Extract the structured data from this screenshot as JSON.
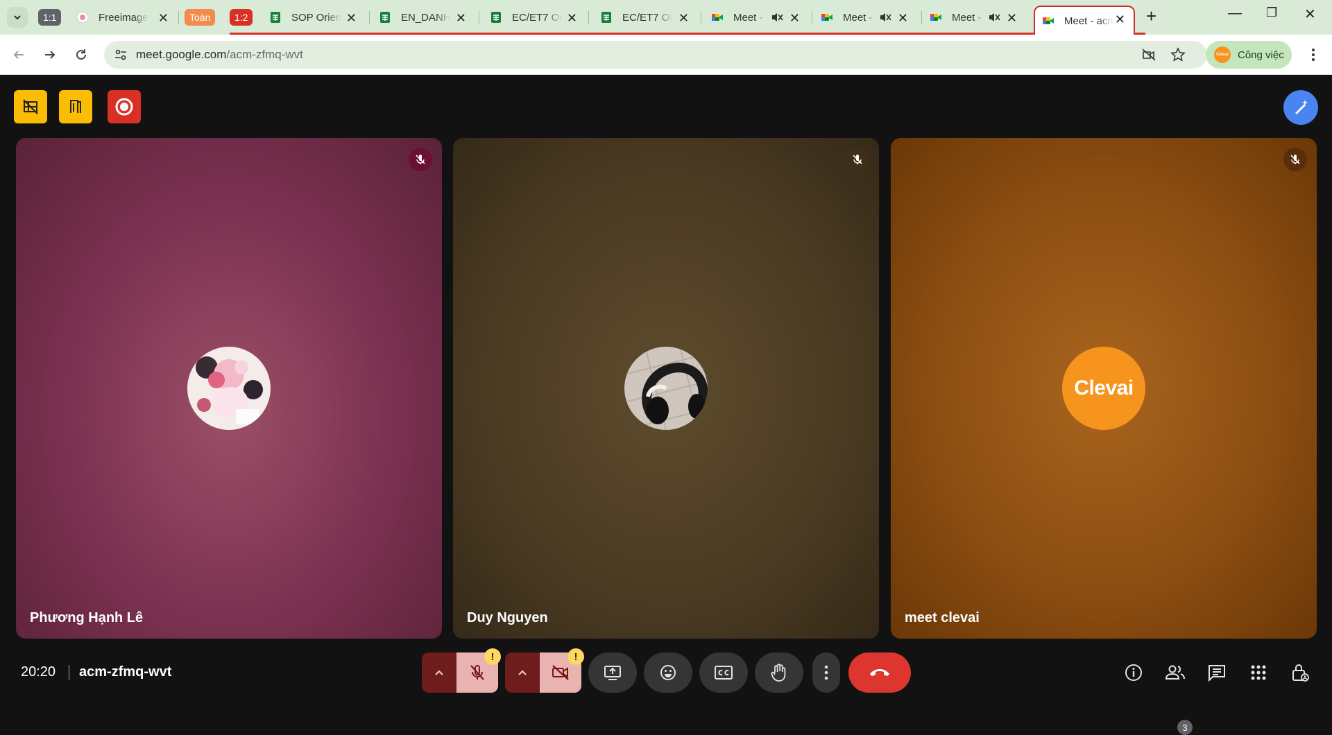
{
  "browser": {
    "tab_groups": [
      {
        "label": "1:1",
        "color": "#5f6368"
      },
      {
        "label": "Toán",
        "color": "#f28b4c"
      },
      {
        "label": "1:2",
        "color": "#d93025"
      }
    ],
    "tabs": [
      {
        "title": "Freeimage",
        "icon": "freeimage-icon"
      },
      {
        "title": "SOP Orien",
        "icon": "google-sheets-icon"
      },
      {
        "title": "EN_DANH",
        "icon": "google-sheets-icon"
      },
      {
        "title": "EC/ET7 Or",
        "icon": "google-sheets-icon"
      },
      {
        "title": "EC/ET7 Or",
        "icon": "google-sheets-icon"
      },
      {
        "title": "Meet -",
        "icon": "google-meet-icon",
        "muted": true
      },
      {
        "title": "Meet -",
        "icon": "google-meet-icon",
        "muted": true
      },
      {
        "title": "Meet -",
        "icon": "google-meet-icon",
        "muted": true
      },
      {
        "title": "Meet - acm",
        "icon": "google-meet-icon",
        "active": true
      }
    ],
    "url_host": "meet.google.com",
    "url_path": "/acm-zfmq-wvt",
    "profile_label": "Công việc",
    "profile_avatar_text": "Clevai"
  },
  "meet": {
    "participants": [
      {
        "name": "Phương Hạnh Lê",
        "muted": true
      },
      {
        "name": "Duy Nguyen",
        "muted": true
      },
      {
        "name": "meet clevai",
        "muted": true,
        "avatar_text": "Clevai"
      }
    ],
    "time": "20:20",
    "meeting_code": "acm-zfmq-wvt",
    "participant_count": "3",
    "warning_mark": "!",
    "colors": {
      "end_call": "#dc362e",
      "control_bg": "#333537",
      "muted_red": "#e8b3b0",
      "accent_blue": "#4a84f0"
    }
  }
}
